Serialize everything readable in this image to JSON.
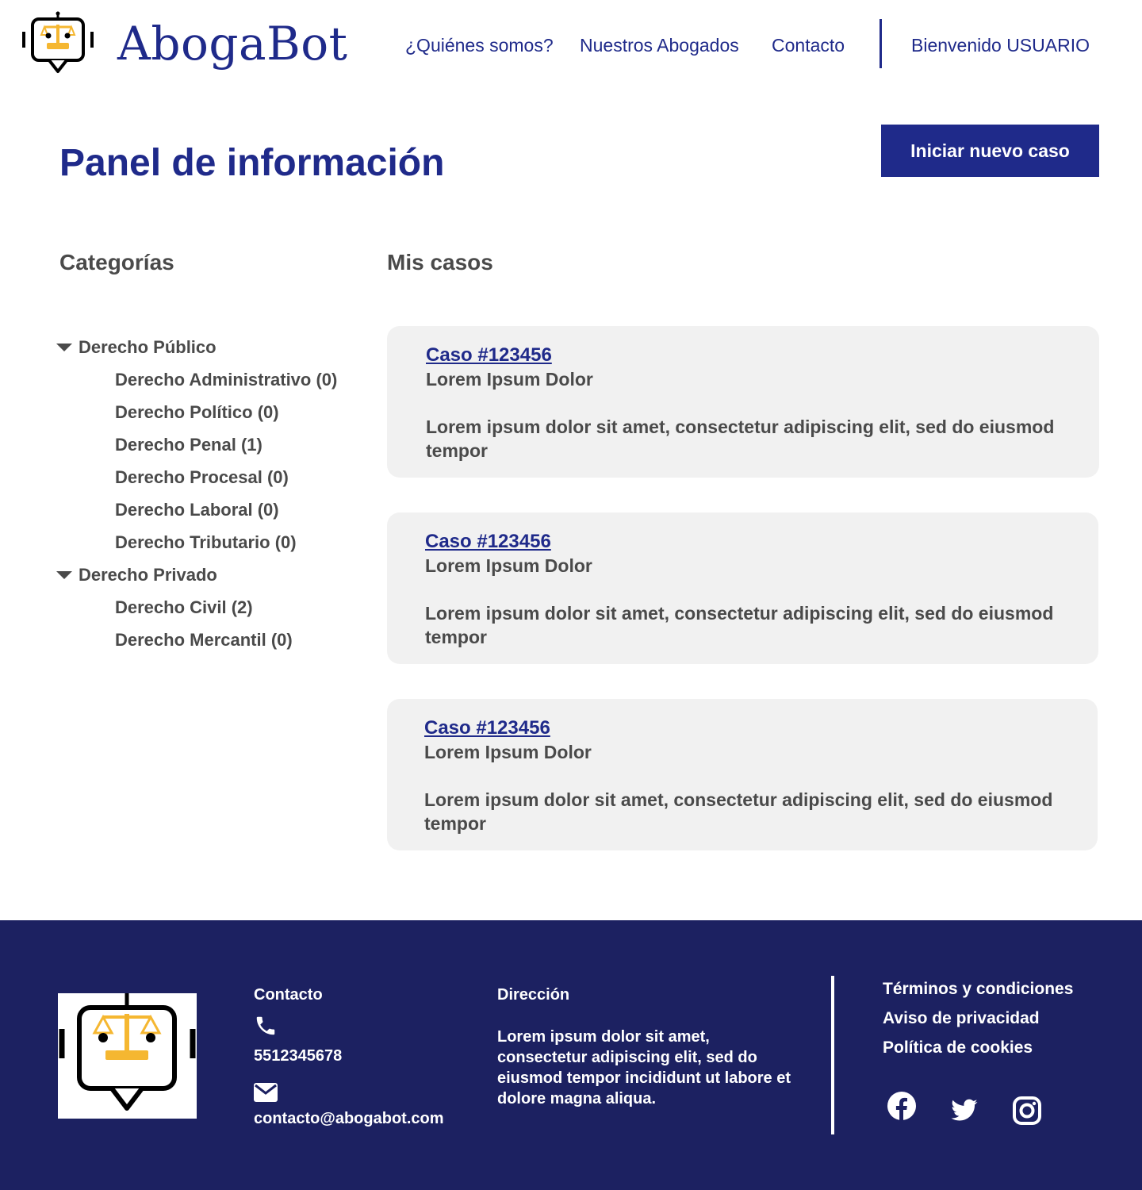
{
  "header": {
    "brand": "AbogaBot",
    "nav": [
      "¿Quiénes somos?",
      "Nuestros Abogados",
      "Contacto"
    ],
    "welcome": "Bienvenido USUARIO"
  },
  "page": {
    "title": "Panel de información",
    "new_case_button": "Iniciar nuevo caso"
  },
  "categories": {
    "heading": "Categorías",
    "groups": [
      {
        "label": "Derecho Público",
        "items": [
          "Derecho Administrativo (0)",
          "Derecho Político (0)",
          "Derecho Penal (1)",
          "Derecho Procesal (0)",
          "Derecho Laboral (0)",
          "Derecho Tributario (0)"
        ]
      },
      {
        "label": "Derecho Privado",
        "items": [
          "Derecho Civil (2)",
          "Derecho Mercantil (0)"
        ]
      }
    ]
  },
  "cases": {
    "heading": "Mis casos",
    "items": [
      {
        "id": "Caso #123456",
        "subtitle": "Lorem Ipsum Dolor",
        "description": "Lorem ipsum dolor sit amet, consectetur adipiscing elit, sed do eiusmod tempor"
      },
      {
        "id": "Caso #123456",
        "subtitle": "Lorem Ipsum Dolor",
        "description": "Lorem ipsum dolor sit amet, consectetur adipiscing elit, sed do eiusmod tempor"
      },
      {
        "id": "Caso #123456",
        "subtitle": "Lorem Ipsum Dolor",
        "description": "Lorem ipsum dolor sit amet, consectetur adipiscing elit, sed do eiusmod tempor"
      }
    ]
  },
  "footer": {
    "contact_heading": "Contacto",
    "phone": "5512345678",
    "email": "contacto@abogabot.com",
    "address_heading": "Dirección",
    "address": "Lorem ipsum dolor sit amet, consectetur adipiscing elit, sed do eiusmod tempor incididunt ut labore et dolore magna aliqua.",
    "links": [
      "Términos y condiciones",
      "Aviso de privacidad",
      "Política de cookies"
    ],
    "social_icons": [
      "facebook-icon",
      "twitter-icon",
      "instagram-icon"
    ]
  },
  "colors": {
    "brand_blue": "#1f2a8a",
    "footer_bg": "#1c2161",
    "card_bg": "#f1f1f1",
    "text_gray": "#4a4a4a",
    "scale_gold": "#f5b731"
  }
}
